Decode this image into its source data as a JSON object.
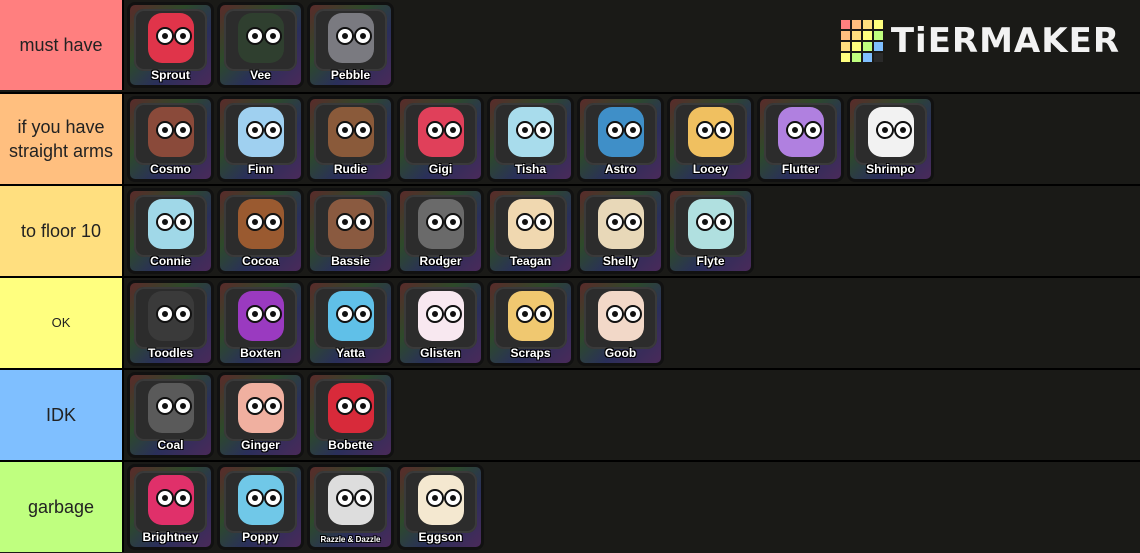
{
  "logo": {
    "text": "TiERMAKER",
    "grid_colors": [
      "#ff7f7f",
      "#ffbf7f",
      "#ffdf7f",
      "#ffff7f",
      "#ffbf7f",
      "#ffdf7f",
      "#ffff7f",
      "#bfff7f",
      "#ffdf7f",
      "#ffff7f",
      "#bfff7f",
      "#7fbfff",
      "#ffff7f",
      "#bfff7f",
      "#7fbfff",
      "#2a2a2a"
    ]
  },
  "tiers": [
    {
      "label": "must have",
      "color": "#ff7f7f",
      "items": [
        "Sprout",
        "Vee",
        "Pebble"
      ]
    },
    {
      "label": "if you have straight arms",
      "color": "#ffbf7f",
      "items": [
        "Cosmo",
        "Finn",
        "Rudie",
        "Gigi",
        "Tisha",
        "Astro",
        "Looey",
        "Flutter",
        "Shrimpo"
      ]
    },
    {
      "label": "to floor 10",
      "color": "#ffdf7f",
      "items": [
        "Connie",
        "Cocoa",
        "Bassie",
        "Rodger",
        "Teagan",
        "Shelly",
        "Flyte"
      ]
    },
    {
      "label": "OK",
      "color": "#ffff7f",
      "items": [
        "Toodles",
        "Boxten",
        "Yatta",
        "Glisten",
        "Scraps",
        "Goob"
      ]
    },
    {
      "label": "IDK",
      "color": "#7fbfff",
      "items": [
        "Coal",
        "Ginger",
        "Bobette"
      ]
    },
    {
      "label": "garbage",
      "color": "#bfff7f",
      "items": [
        "Brightney",
        "Poppy",
        "Razzle & Dazzle",
        "Eggson"
      ]
    }
  ],
  "character_colors": {
    "Sprout": "#e0344a",
    "Vee": "#2f3f2f",
    "Pebble": "#7a7a80",
    "Cosmo": "#8a4a3a",
    "Finn": "#9fd0f0",
    "Rudie": "#8a5a3a",
    "Gigi": "#e0405a",
    "Tisha": "#a8dcec",
    "Astro": "#3f8fc8",
    "Looey": "#f0c060",
    "Flutter": "#b080e0",
    "Shrimpo": "#f2f2f2",
    "Connie": "#a0d8e8",
    "Cocoa": "#9a5a30",
    "Bassie": "#8a5a40",
    "Rodger": "#6a6a6a",
    "Teagan": "#f0d8b0",
    "Shelly": "#e8d8b8",
    "Flyte": "#b0e0e0",
    "Toodles": "#3a3a3a",
    "Boxten": "#9a3ac0",
    "Yatta": "#60c0e8",
    "Glisten": "#f8e8f0",
    "Scraps": "#f0c870",
    "Goob": "#f2d8c8",
    "Coal": "#5a5a5a",
    "Ginger": "#f0b0a0",
    "Bobette": "#d82a3a",
    "Brightney": "#e0306a",
    "Poppy": "#70c8e8",
    "Razzle & Dazzle": "#dddddd",
    "Eggson": "#f4e8d0"
  }
}
